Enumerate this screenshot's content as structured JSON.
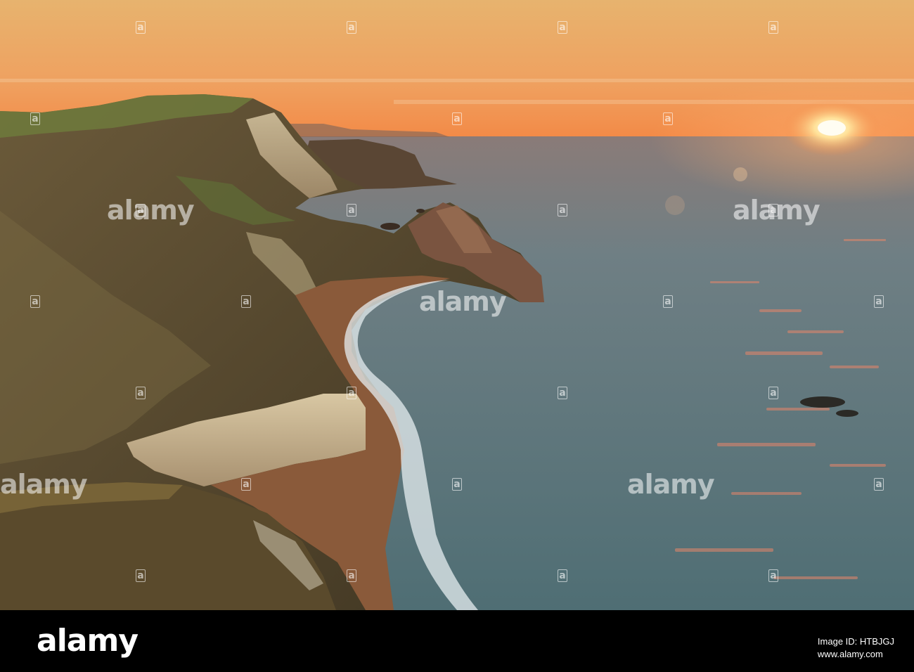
{
  "photo": {
    "sky_colors": [
      "#e9b46f",
      "#f0a25e",
      "#f28a48"
    ],
    "sea_color": "#5c7a80",
    "sun_color": "#fff3c8"
  },
  "watermark": {
    "label": "alamy",
    "badge": "a"
  },
  "footer": {
    "logo": "alamy",
    "image_id_label": "Image ID: HTBJGJ",
    "site": "www.alamy.com"
  }
}
